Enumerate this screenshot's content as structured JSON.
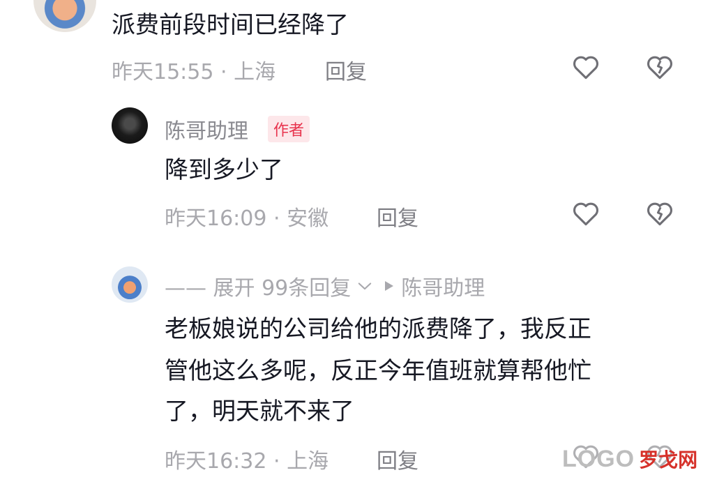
{
  "comments": [
    {
      "text": "派费前段时间已经降了",
      "time_location": "昨天15:55 · 上海",
      "reply_label": "回复"
    },
    {
      "username": "陈哥助理",
      "badge": "作者",
      "text": "降到多少了",
      "time_location": "昨天16:09 · 安徽",
      "reply_label": "回复"
    },
    {
      "expand_label": "—— 展开 99条回复",
      "reply_to": "陈哥助理",
      "text_lines": [
        "老板娘说的公司给他的派费降了，我反正",
        "管他这么多呢，反正今年值班就算帮他忙",
        "了，明天就不来了"
      ],
      "time_location": "昨天16:32 · 上海",
      "reply_label": "回复"
    }
  ],
  "watermark": {
    "letters": "LOGO",
    "site": "罗戈网"
  },
  "colors": {
    "text": "#161823",
    "meta": "#a8a8ad",
    "badge": "#e8334d",
    "badge_bg": "#fde7ea",
    "watermark_red": "#d6312a"
  },
  "icons": [
    "heart-icon",
    "broken-heart-icon",
    "chevron-down-icon",
    "play-triangle-icon"
  ]
}
